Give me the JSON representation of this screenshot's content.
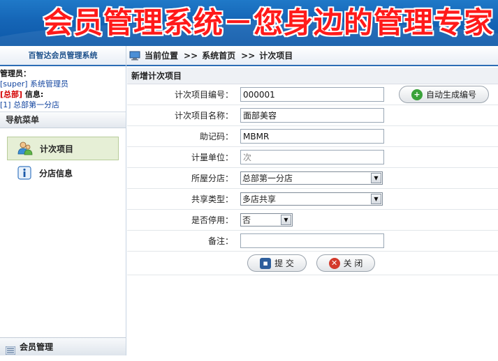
{
  "banner": {
    "title": "会员管理系统－您身边的管理专家"
  },
  "sidebar": {
    "system_name": "百智达会员管理系统",
    "admin_label": "管理员：",
    "admin_user": "[super] 系统管理员",
    "branch_tag": "[总部]",
    "info_label": " 信息:",
    "branch_info": "[1] 总部第一分店",
    "nav_header": "导航菜单",
    "items": [
      {
        "label": "计次项目",
        "icon": "user-group-icon",
        "active": true
      },
      {
        "label": "分店信息",
        "icon": "info-icon",
        "active": false
      }
    ],
    "bottom_label": "会员管理"
  },
  "breadcrumb": {
    "label": "当前位置",
    "sep": ">>",
    "level1": "系统首页",
    "level2": "计次项目"
  },
  "form": {
    "title": "新增计次项目",
    "fields": {
      "code": {
        "label": "计次项目编号：",
        "value": "000001"
      },
      "name": {
        "label": "计次项目名称：",
        "value": "面部美容"
      },
      "mnemonic": {
        "label": "助记码：",
        "value": "MBMR"
      },
      "unit": {
        "label": "计量单位：",
        "placeholder": "次"
      },
      "branch": {
        "label": "所屋分店：",
        "value": "总部第一分店"
      },
      "share": {
        "label": "共享类型：",
        "value": "多店共享"
      },
      "disabled": {
        "label": "是否停用：",
        "value": "否"
      },
      "remark": {
        "label": "备注：",
        "value": ""
      }
    },
    "auto_code_button": "自动生成编号",
    "submit_button": "提 交",
    "close_button": "关 闭"
  },
  "colors": {
    "banner_bg": "#1565b6",
    "banner_text": "#ff1a1a",
    "accent_border": "#2c6db5",
    "active_nav_bg": "#e6efd6"
  }
}
